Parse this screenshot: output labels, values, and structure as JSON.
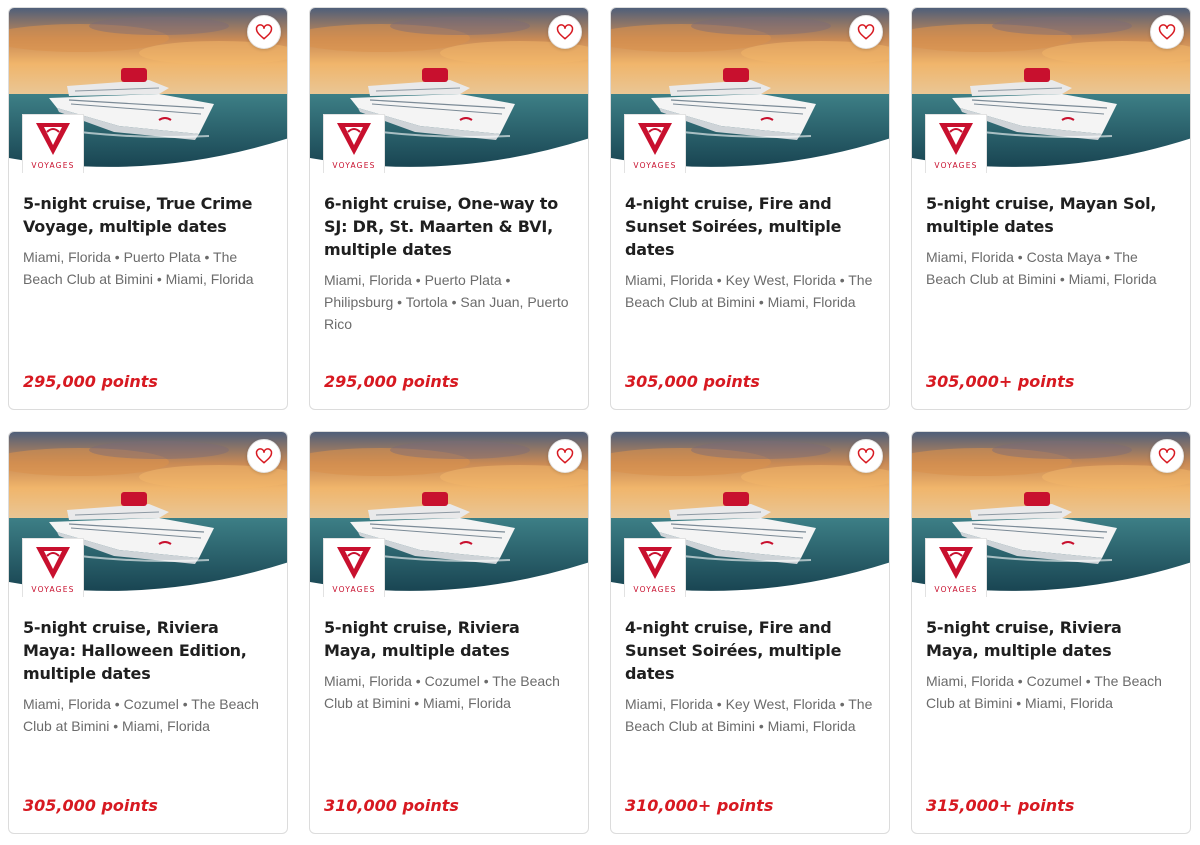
{
  "brand": {
    "logo_word": "VOYAGES",
    "accent": "#d71921"
  },
  "cards": [
    {
      "title": "5-night cruise, True Crime Voyage, multiple dates",
      "route": "Miami, Florida • Puerto Plata • The Beach Club at Bimini • Miami, Florida",
      "price": "295,000 points"
    },
    {
      "title": "6-night cruise, One-way to SJ: DR, St. Maarten & BVI, multiple dates",
      "route": "Miami, Florida • Puerto Plata • Philipsburg • Tortola • San Juan, Puerto Rico",
      "price": "295,000 points"
    },
    {
      "title": "4-night cruise, Fire and Sunset Soirées, multiple dates",
      "route": "Miami, Florida • Key West, Florida • The Beach Club at Bimini • Miami, Florida",
      "price": "305,000 points"
    },
    {
      "title": "5-night cruise, Mayan Sol, multiple dates",
      "route": "Miami, Florida • Costa Maya • The Beach Club at Bimini • Miami, Florida",
      "price": "305,000+ points"
    },
    {
      "title": "5-night cruise, Riviera Maya: Halloween Edition, multiple dates",
      "route": "Miami, Florida • Cozumel • The Beach Club at Bimini • Miami, Florida",
      "price": "305,000 points"
    },
    {
      "title": "5-night cruise, Riviera Maya, multiple dates",
      "route": "Miami, Florida • Cozumel • The Beach Club at Bimini • Miami, Florida",
      "price": "310,000 points"
    },
    {
      "title": "4-night cruise, Fire and Sunset Soirées, multiple dates",
      "route": "Miami, Florida • Key West, Florida • The Beach Club at Bimini • Miami, Florida",
      "price": "310,000+ points"
    },
    {
      "title": "5-night cruise, Riviera Maya, multiple dates",
      "route": "Miami, Florida • Cozumel • The Beach Club at Bimini • Miami, Florida",
      "price": "315,000+ points"
    }
  ]
}
